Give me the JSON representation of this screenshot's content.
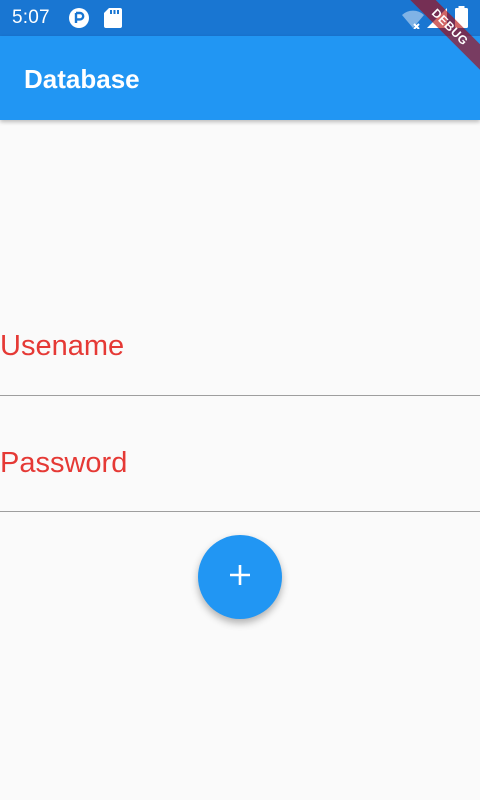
{
  "status_bar": {
    "time": "5:07",
    "icons": [
      "pocket-casts-icon",
      "sd-card-icon",
      "wifi-off-icon",
      "signal-icon",
      "battery-icon"
    ]
  },
  "app_bar": {
    "title": "Database"
  },
  "debug_banner": {
    "label": "DEBUG"
  },
  "form": {
    "username_label": "Usename",
    "password_label": "Password"
  },
  "fab": {
    "icon": "add-icon"
  },
  "colors": {
    "status_bar": "#1976d2",
    "app_bar": "#2196f3",
    "label": "#e53935",
    "background": "#fafafa"
  }
}
